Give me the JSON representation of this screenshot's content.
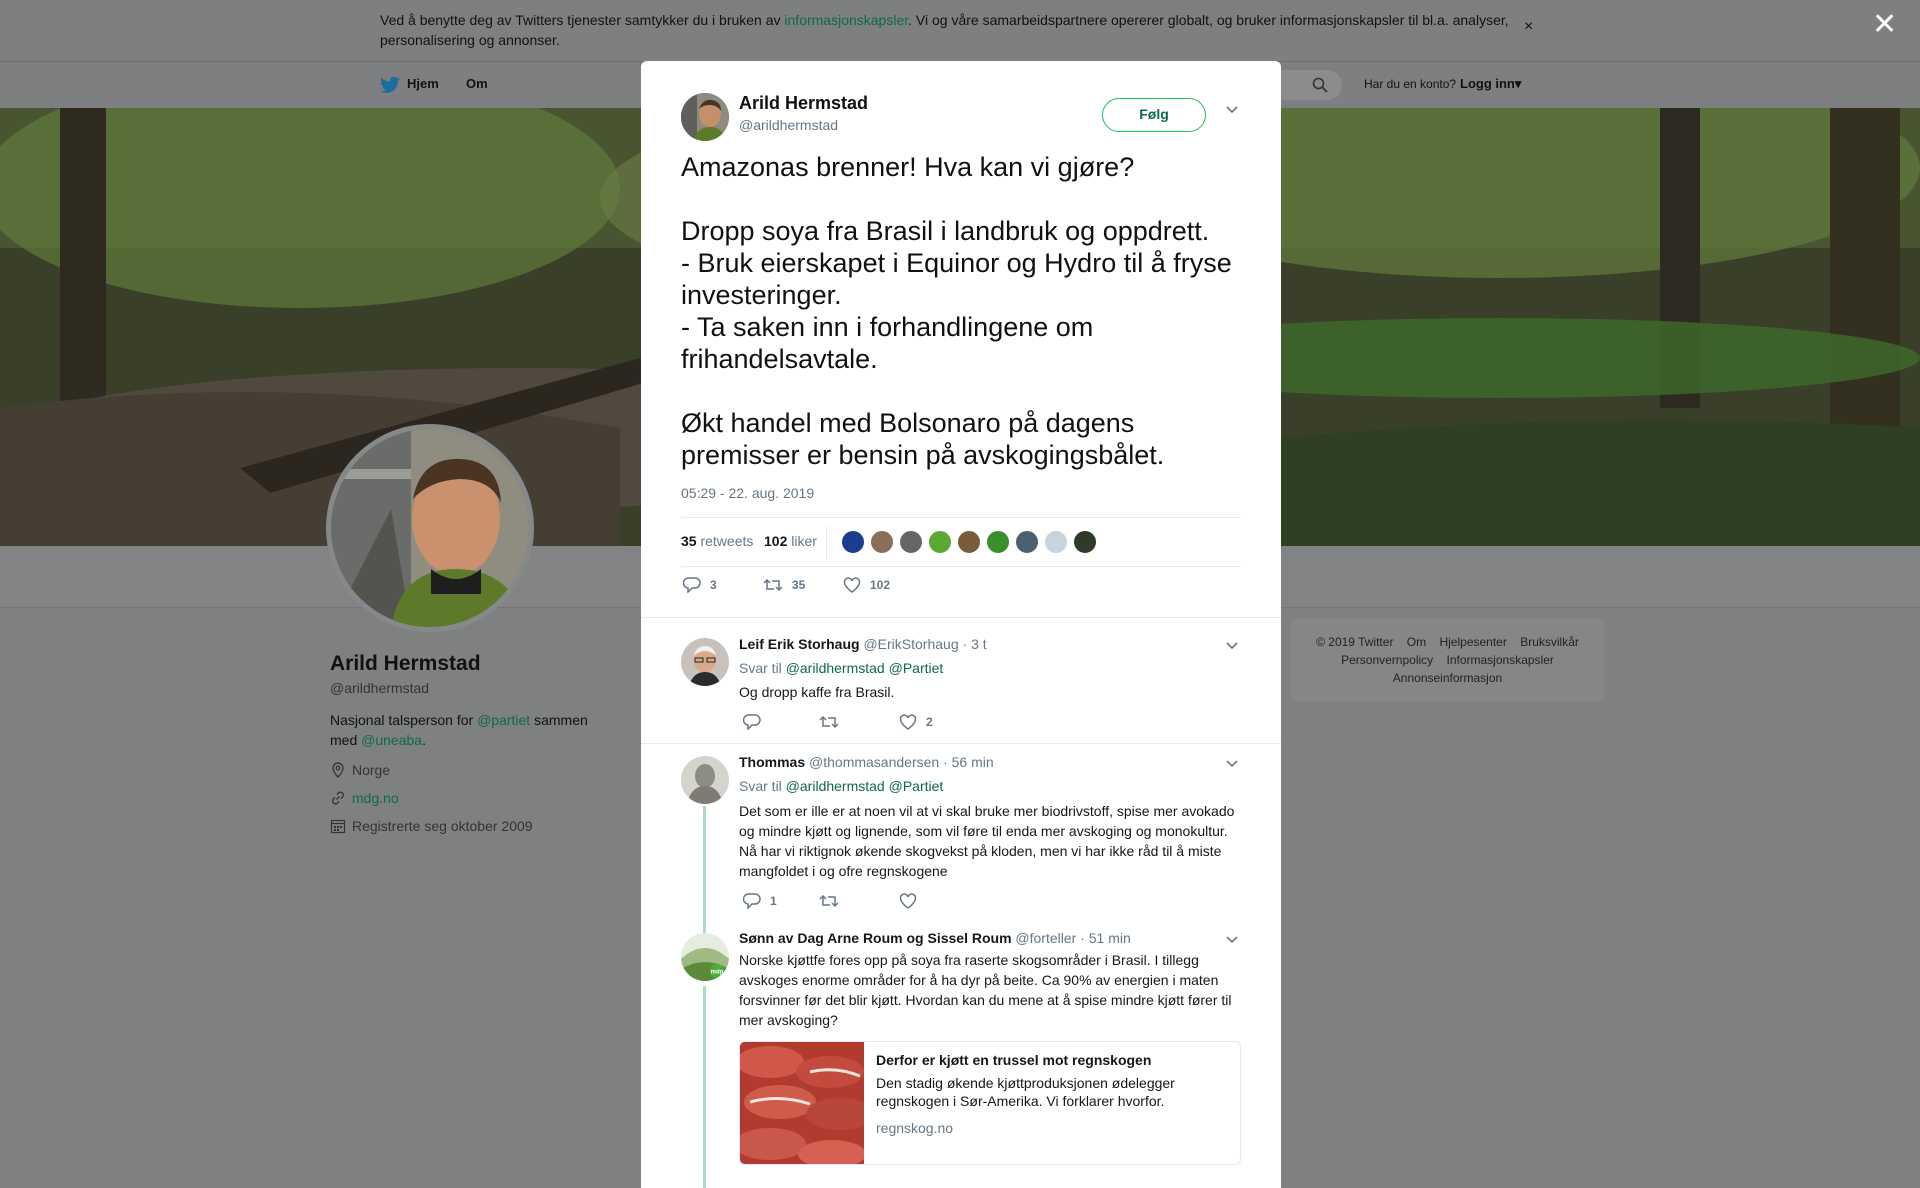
{
  "cookie_banner": {
    "text_before": "Ved å benytte deg av Twitters tjenester samtykker du i bruken av ",
    "link": "informasjonskapsler",
    "text_after": ". Vi og våre samarbeidspartnere opererer globalt, og bruker informasjonskapsler til bl.a. analyser, personalisering og annonser.",
    "close": "×"
  },
  "overlay_close": "✕",
  "nav": {
    "home": "Hjem",
    "about": "Om",
    "login_question": "Har du en konto?",
    "login": "Logg inn▾"
  },
  "profile": {
    "name": "Arild Hermstad",
    "handle": "@arildhermstad",
    "bio_1": "Nasjonal talsperson for ",
    "bio_link_1": "@partiet",
    "bio_2": " sammen med ",
    "bio_link_2": "@uneaba",
    "bio_3": ".",
    "location": "Norge",
    "website": "mdg.no",
    "joined": "Registrerte seg oktober 2009"
  },
  "footer": {
    "items": [
      "© 2019 Twitter",
      "Om",
      "Hjelpesenter",
      "Bruksvilkår",
      "Personvernpolicy",
      "Informasjonskapsler",
      "Annonseinformasjon"
    ]
  },
  "tweet": {
    "name": "Arild Hermstad",
    "handle": "@arildhermstad",
    "follow": "Følg",
    "text": "Amazonas brenner! Hva kan vi gjøre?\n\nDropp soya fra Brasil i landbruk og oppdrett.\n- Bruk eierskapet i Equinor og Hydro til å fryse investeringer.\n-  Ta saken inn i forhandlingene om frihandelsavtale.\n\nØkt handel med Bolsonaro på dagens premisser er bensin på avskogingsbålet.",
    "time": "05:29 - 22. aug. 2019",
    "retweets_count": "35",
    "retweets_label": "retweets",
    "likes_count": "102",
    "likes_label": "liker",
    "liker_colors": [
      "#1d3d8f",
      "#8a6e5a",
      "#666666",
      "#5aa832",
      "#7a5c3a",
      "#3b8f2a",
      "#4b6070",
      "#c9d3db",
      "#2f3a2a"
    ],
    "actions": {
      "replies": "3",
      "retweets": "35",
      "likes": "102"
    }
  },
  "replies": [
    {
      "name": "Leif Erik Storhaug",
      "handle": "@ErikStorhaug",
      "time": "· 3 t",
      "reply_to_label": "Svar til ",
      "reply_to": "@arildhermstad @Partiet",
      "text": "Og dropp kaffe fra Brasil.",
      "counts": {
        "replies": "",
        "retweets": "",
        "likes": "2"
      }
    },
    {
      "name": "Thommas",
      "handle": "@thommasandersen",
      "time": "· 56 min",
      "reply_to_label": "Svar til ",
      "reply_to": "@arildhermstad @Partiet",
      "text": "Det som er ille er at noen vil at vi skal bruke mer biodrivstoff, spise mer avokado og mindre kjøtt og lignende, som vil føre til enda mer avskoging og monokultur. Nå har vi riktignok økende skogvekst på kloden, men vi har ikke råd til å miste mangfoldet i og ofre regnskogene",
      "counts": {
        "replies": "1",
        "retweets": "",
        "likes": ""
      }
    },
    {
      "name": "Sønn av Dag Arne Roum og Sissel Roum",
      "handle": "@forteller",
      "time": "· 51 min",
      "text": "Norske kjøttfe fores opp på soya fra raserte skogsområder i Brasil. I tillegg avskoges enorme områder for å ha dyr på beite. Ca 90% av energien i maten forsvinner før det blir kjøtt. Hvordan kan du mene at å spise mindre kjøtt fører til mer avskoging?",
      "avatar_badge": "mdg",
      "card": {
        "title": "Derfor er kjøtt en trussel mot regnskogen",
        "description": "Den stadig økende kjøttproduksjonen ødelegger regnskogen i Sør-Amerika. Vi forklarer hvorfor.",
        "domain": "regnskog.no"
      }
    }
  ]
}
